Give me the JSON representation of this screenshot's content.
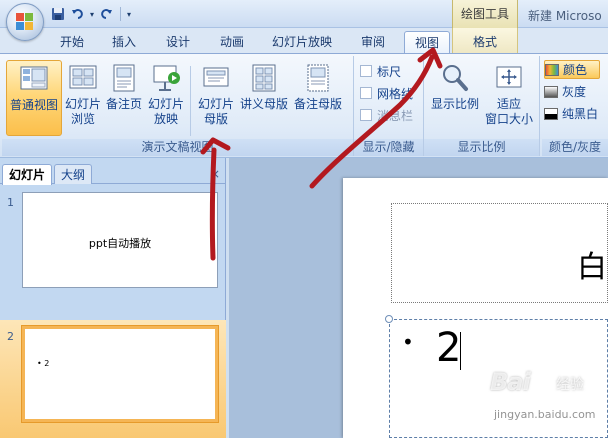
{
  "window": {
    "context_tab_group": "绘图工具",
    "app_title": "新建 Microso"
  },
  "quick_access": {
    "icons": [
      "save-icon",
      "undo-icon",
      "redo-icon",
      "customize-icon"
    ]
  },
  "tabs": [
    {
      "label": "开始"
    },
    {
      "label": "插入"
    },
    {
      "label": "设计"
    },
    {
      "label": "动画"
    },
    {
      "label": "幻灯片放映"
    },
    {
      "label": "审阅"
    },
    {
      "label": "视图",
      "active": true
    },
    {
      "label": "格式"
    }
  ],
  "ribbon": {
    "presentation_views": {
      "label": "演示文稿视图",
      "buttons": [
        {
          "line1": "普通视图",
          "line2": "",
          "selected": true
        },
        {
          "line1": "幻灯片",
          "line2": "浏览"
        },
        {
          "line1": "备注页",
          "line2": ""
        },
        {
          "line1": "幻灯片",
          "line2": "放映"
        },
        {
          "line1": "幻灯片",
          "line2": "母版"
        },
        {
          "line1": "讲义母版",
          "line2": ""
        },
        {
          "line1": "备注母版",
          "line2": ""
        }
      ]
    },
    "show_hide": {
      "label": "显示/隐藏",
      "items": [
        {
          "text": "标尺"
        },
        {
          "text": "网格线"
        },
        {
          "text": "消息栏"
        }
      ]
    },
    "zoom": {
      "label": "显示比例",
      "zoom_button": "显示比例",
      "fit_line1": "适应",
      "fit_line2": "窗口大小"
    },
    "color": {
      "label": "颜色/灰度",
      "items": [
        {
          "text": "颜色",
          "selected": true
        },
        {
          "text": "灰度"
        },
        {
          "text": "纯黑白"
        }
      ]
    }
  },
  "left_pane": {
    "tab_slides": "幻灯片",
    "tab_outline": "大纲",
    "close": "×",
    "slides": [
      {
        "number": "1",
        "text": "ppt自动播放"
      },
      {
        "number": "2",
        "text": "2"
      }
    ]
  },
  "editor": {
    "bullet": "•",
    "body_text": "2",
    "title_glyph": "白"
  },
  "colors": {
    "annotation_arrow": "#b3191f",
    "selected_orange": "#fbbf4b",
    "ribbon_blue": "#dbe7f5"
  },
  "watermark": {
    "logo": "Bai",
    "logo_cn": "经验",
    "url": "jingyan.baidu.com"
  }
}
